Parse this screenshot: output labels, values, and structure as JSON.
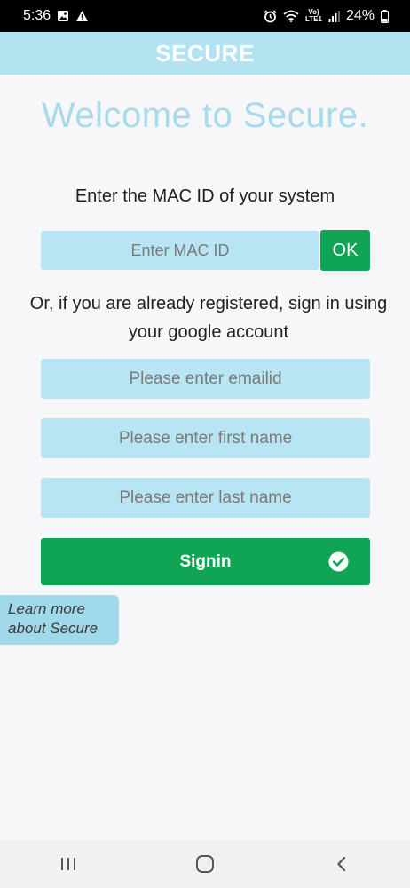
{
  "status_bar": {
    "time": "5:36",
    "network_label_top": "Vo)",
    "network_label_bottom": "LTE1",
    "battery": "24%",
    "icons": [
      "image-icon",
      "warning-icon",
      "alarm-icon",
      "wifi-icon",
      "signal-icon",
      "battery-icon"
    ]
  },
  "app_bar": {
    "title": "SECURE"
  },
  "main": {
    "welcome": "Welcome to Secure.",
    "mac_prompt": "Enter the MAC ID of your system",
    "mac_placeholder": "Enter MAC ID",
    "ok_label": "OK",
    "or_text": "Or, if you are already registered, sign in using your google account",
    "email_placeholder": "Please enter emailid",
    "first_name_placeholder": "Please enter first name",
    "last_name_placeholder": "Please enter last name",
    "signin_label": "Signin",
    "learn_more_line1": "Learn more",
    "learn_more_line2": "about Secure"
  },
  "colors": {
    "accent_light_blue": "#b3e2f0",
    "field_blue": "#b8e5f3",
    "green": "#10a555",
    "welcome_text": "#a7dbe9"
  }
}
